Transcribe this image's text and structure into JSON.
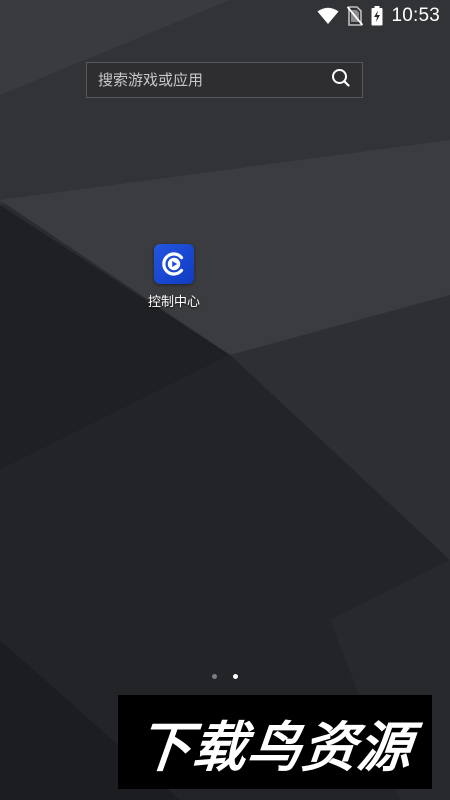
{
  "status_bar": {
    "time": "10:53",
    "icons": [
      "wifi-icon",
      "no-sim-icon",
      "battery-charging-icon"
    ]
  },
  "search": {
    "placeholder": "搜索游戏或应用",
    "value": "",
    "icon": "search-icon"
  },
  "apps": [
    {
      "label": "控制中心",
      "icon": "control-center-icon",
      "icon_color": "#1f4fd8"
    }
  ],
  "pager": {
    "pages": 2,
    "current_page": 2
  },
  "watermark": {
    "text": "下载鸟资源"
  },
  "colors": {
    "wallpaper": "#2a2b2e",
    "status_text": "#ffffff",
    "app_icon_bg": "#1f4fd8"
  }
}
